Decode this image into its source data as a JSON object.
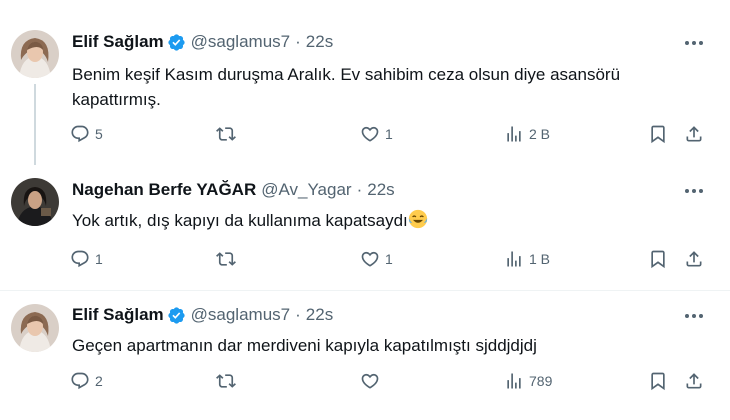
{
  "tweets": [
    {
      "name": "Elif Sağlam",
      "handle": "@saglamus7",
      "dot": "·",
      "time": "22s",
      "text": "Benim keşif Kasım duruşma Aralık. Ev sahibim ceza olsun diye asansörü kapattırmış.",
      "replies": "5",
      "retweets": "",
      "likes": "1",
      "views": "2 B"
    },
    {
      "name": "Nagehan Berfe YAĞAR",
      "handle": "@Av_Yagar",
      "dot": "·",
      "time": "22s",
      "text": "Yok artık, dış kapıyı da kullanıma kapatsaydı",
      "replies": "1",
      "retweets": "",
      "likes": "1",
      "views": "1 B"
    },
    {
      "name": "Elif Sağlam",
      "handle": "@saglamus7",
      "dot": "·",
      "time": "22s",
      "text": "Geçen apartmanın dar merdiveni kapıyla kapatılmıştı sjddjdjdj",
      "replies": "2",
      "retweets": "",
      "likes": "",
      "views": "789"
    }
  ],
  "icons": {
    "verified": "verified-badge-icon",
    "more": "more-icon",
    "reply": "reply-icon",
    "retweet": "retweet-icon",
    "like": "like-icon",
    "views": "views-icon",
    "bookmark": "bookmark-icon",
    "share": "share-icon",
    "emoji": "tears-of-joy-emoji-icon"
  },
  "colors": {
    "text": "#0f1419",
    "secondary": "#536471",
    "verified": "#1d9bf0",
    "separator": "#eff3f4"
  }
}
